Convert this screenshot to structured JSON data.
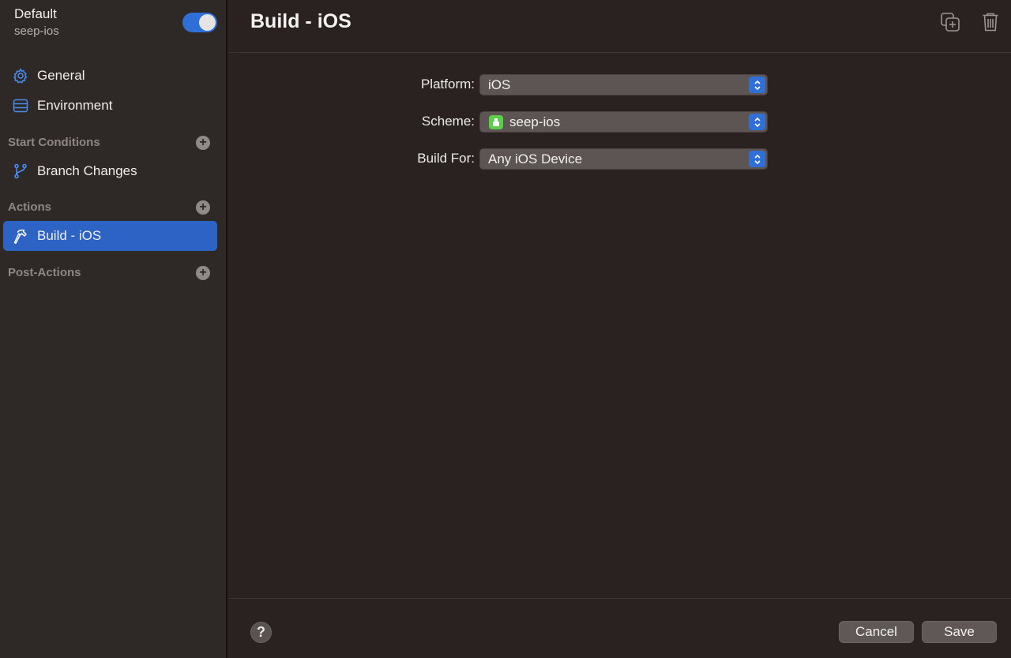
{
  "sidebar": {
    "workflow_title": "Default",
    "workflow_subtitle": "seep-ios",
    "enabled": true,
    "items": [
      {
        "label": "General",
        "icon": "gear-icon"
      },
      {
        "label": "Environment",
        "icon": "environment-icon"
      }
    ],
    "sections": [
      {
        "title": "Start Conditions",
        "items": [
          {
            "label": "Branch Changes",
            "icon": "branch-icon"
          }
        ]
      },
      {
        "title": "Actions",
        "items": [
          {
            "label": "Build - iOS",
            "icon": "hammer-icon",
            "selected": true
          }
        ]
      },
      {
        "title": "Post-Actions",
        "items": []
      }
    ]
  },
  "main": {
    "title": "Build - iOS",
    "fields": [
      {
        "label": "Platform:",
        "value": "iOS"
      },
      {
        "label": "Scheme:",
        "value": "seep-ios",
        "icon": "app-icon"
      },
      {
        "label": "Build For:",
        "value": "Any iOS Device"
      }
    ]
  },
  "footer": {
    "help_label": "?",
    "cancel_label": "Cancel",
    "save_label": "Save"
  },
  "colors": {
    "accent": "#2d63c5",
    "toggle_on": "#2f6fd6",
    "scheme_icon": "#5ccf4a"
  }
}
